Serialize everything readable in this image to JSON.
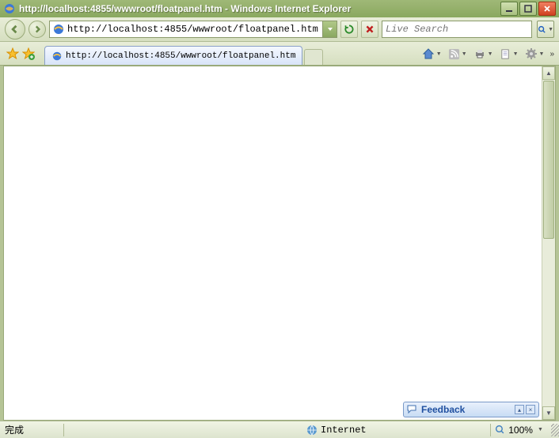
{
  "window": {
    "title": "http://localhost:4855/wwwroot/floatpanel.htm - Windows Internet Explorer"
  },
  "address": {
    "url": "http://localhost:4855/wwwroot/floatpanel.htm"
  },
  "search": {
    "placeholder": "Live Search"
  },
  "tab": {
    "title": "http://localhost:4855/wwwroot/floatpanel.htm"
  },
  "feedback": {
    "label": "Feedback"
  },
  "status": {
    "text": "完成",
    "zone": "Internet",
    "zoom": "100%"
  }
}
